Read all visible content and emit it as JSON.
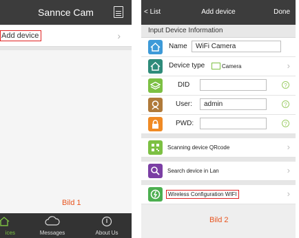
{
  "screen1": {
    "title": "Sannce Cam",
    "add_device_label": "Add device",
    "chevron": "›",
    "caption": "Bild 1",
    "tabs": [
      {
        "label": "ices",
        "icon": "home-icon"
      },
      {
        "label": "Messages",
        "icon": "cloud-icon"
      },
      {
        "label": "About Us",
        "icon": "info-icon"
      }
    ]
  },
  "screen2": {
    "back_label": "List",
    "title": "Add device",
    "done_label": "Done",
    "section_title": "Input Device Information",
    "name": {
      "label": "Name",
      "value": "WiFi Camera"
    },
    "device_type": {
      "label": "Device type",
      "value": "Camera"
    },
    "did": {
      "label": "DID",
      "value": ""
    },
    "user": {
      "label": "User:",
      "value": "admin"
    },
    "pwd": {
      "label": "PWD:",
      "value": ""
    },
    "help_mark": "?",
    "chevron": "›",
    "actions": {
      "scan": "Scanning device QRcode",
      "search": "Search device in Lan",
      "wifi": "Wireless Configuration WIFI"
    },
    "caption": "Bild 2"
  },
  "colors": {
    "navbar": "#3c3c3c",
    "highlight": "#e02020",
    "caption": "#e8541e",
    "accent_green": "#7cc043",
    "accent_blue": "#3d9ad8",
    "accent_purple": "#7b3fa4",
    "accent_orange": "#f08a24",
    "accent_brown": "#b07a3a"
  }
}
